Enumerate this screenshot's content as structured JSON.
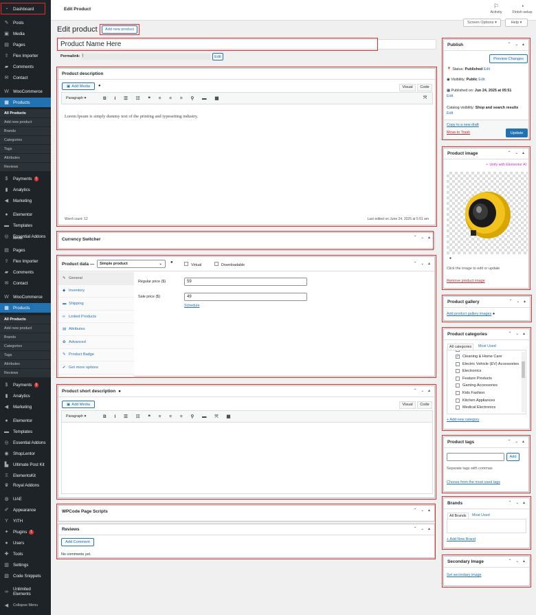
{
  "sidebar": {
    "top_items": [
      {
        "label": "Dashboard",
        "icon": "dashboard-icon",
        "glyph": "◔"
      },
      {
        "label": "Posts",
        "icon": "pin-icon",
        "glyph": "✎"
      },
      {
        "label": "Media",
        "icon": "media-icon",
        "glyph": "▣"
      },
      {
        "label": "Pages",
        "icon": "pages-icon",
        "glyph": "▤"
      },
      {
        "label": "Flex Importer",
        "icon": "importer-icon",
        "glyph": "⇪"
      },
      {
        "label": "Comments",
        "icon": "comments-icon",
        "glyph": "▰"
      },
      {
        "label": "Contact",
        "icon": "mail-icon",
        "glyph": "✉"
      },
      {
        "label": "WooCommerce",
        "icon": "woo-icon",
        "glyph": "W"
      },
      {
        "label": "Products",
        "icon": "products-icon",
        "glyph": "▦"
      }
    ],
    "products_sub": [
      "All Products",
      "Add new product",
      "Brands",
      "Categories",
      "Tags",
      "Attributes",
      "Reviews"
    ],
    "mid_items": [
      {
        "label": "Payments",
        "icon": "payments-icon",
        "glyph": "$",
        "badge": "1"
      },
      {
        "label": "Analytics",
        "icon": "analytics-icon",
        "glyph": "▮"
      },
      {
        "label": "Marketing",
        "icon": "megaphone-icon",
        "glyph": "◀"
      },
      {
        "label": "Elementor",
        "icon": "elementor-icon",
        "glyph": "●"
      },
      {
        "label": "Templates",
        "icon": "folder-icon",
        "glyph": "▬"
      },
      {
        "label": "Essential Addons",
        "icon": "ea-icon",
        "glyph": "◎"
      }
    ],
    "overlap_label": "Media",
    "repeat_items": [
      {
        "label": "Pages",
        "icon": "pages-icon",
        "glyph": "▤"
      },
      {
        "label": "Flex Importer",
        "icon": "importer-icon",
        "glyph": "⇪"
      },
      {
        "label": "Comments",
        "icon": "comments-icon",
        "glyph": "▰"
      },
      {
        "label": "Contact",
        "icon": "mail-icon",
        "glyph": "✉"
      },
      {
        "label": "WooCommerce",
        "icon": "woo-icon",
        "glyph": "W"
      },
      {
        "label": "Products",
        "icon": "products-icon",
        "glyph": "▦"
      }
    ],
    "bottom_items": [
      {
        "label": "Payments",
        "icon": "payments-icon",
        "glyph": "$",
        "badge": "1"
      },
      {
        "label": "Analytics",
        "icon": "analytics-icon",
        "glyph": "▮"
      },
      {
        "label": "Marketing",
        "icon": "megaphone-icon",
        "glyph": "◀"
      },
      {
        "label": "Elementor",
        "icon": "elementor-icon",
        "glyph": "●"
      },
      {
        "label": "Templates",
        "icon": "folder-icon",
        "glyph": "▬"
      },
      {
        "label": "Essential Addons",
        "icon": "ea-icon",
        "glyph": "◎"
      },
      {
        "label": "ShopLentor",
        "icon": "shoplentor-icon",
        "glyph": "◉"
      },
      {
        "label": "Ultimate Post Kit",
        "icon": "upk-icon",
        "glyph": "▙"
      },
      {
        "label": "ElementsKit",
        "icon": "ek-icon",
        "glyph": "Ξ"
      },
      {
        "label": "Royal Addons",
        "icon": "crown-icon",
        "glyph": "♛"
      },
      {
        "label": "UAE",
        "icon": "uae-icon",
        "glyph": "◍"
      },
      {
        "label": "Appearance",
        "icon": "brush-icon",
        "glyph": "✐"
      },
      {
        "label": "YITH",
        "icon": "yith-icon",
        "glyph": "Y"
      },
      {
        "label": "Plugins",
        "icon": "plugin-icon",
        "glyph": "✦",
        "badge": "1"
      },
      {
        "label": "Users",
        "icon": "users-icon",
        "glyph": "●"
      },
      {
        "label": "Tools",
        "icon": "tools-icon",
        "glyph": "✚"
      },
      {
        "label": "Settings",
        "icon": "settings-icon",
        "glyph": "▥"
      },
      {
        "label": "Code Snippets",
        "icon": "code-icon",
        "glyph": "▧"
      }
    ],
    "unlimited_elements": "Unlimited Elements",
    "collapse": "Collapse Menu"
  },
  "topbar": {
    "title": "Edit Product",
    "activity": "Activity",
    "finish": "Finish setup"
  },
  "header": {
    "heading": "Edit product",
    "add_new": "Add new product",
    "screen_options": "Screen Options ▾",
    "help": "Help ▾"
  },
  "product": {
    "title": "Product Name Here",
    "permalink_label": "Permalink:",
    "permalink_value": "|",
    "edit": "Edit"
  },
  "description": {
    "title": "Product description",
    "add_media": "Add Media",
    "tab_visual": "Visual",
    "tab_code": "Code",
    "format": "Paragraph",
    "content": "Lorem Ipsum is simply dummy text of the printing and typesetting industry.",
    "word_count": "Word count: 12",
    "last_edited": "Last edited on June 24, 2025 at 5:51 am"
  },
  "currency": {
    "title": "Currency Switcher"
  },
  "product_data": {
    "title": "Product data —",
    "type": "Simple product",
    "virtual": "Virtual",
    "downloadable": "Downloadable",
    "tabs": [
      {
        "label": "General",
        "glyph": "✎"
      },
      {
        "label": "Inventory",
        "glyph": "◆"
      },
      {
        "label": "Shipping",
        "glyph": "▬"
      },
      {
        "label": "Linked Products",
        "glyph": "∞"
      },
      {
        "label": "Attributes",
        "glyph": "▤"
      },
      {
        "label": "Advanced",
        "glyph": "✿"
      },
      {
        "label": "Product Badge",
        "glyph": "✎"
      },
      {
        "label": "Get more options",
        "glyph": "✔"
      }
    ],
    "regular_label": "Regular price ($)",
    "regular_value": "59",
    "sale_label": "Sale price ($)",
    "sale_value": "49",
    "schedule": "Schedule"
  },
  "short_description": {
    "title": "Product short description",
    "add_media": "Add Media",
    "tab_visual": "Visual",
    "tab_code": "Code",
    "format": "Paragraph"
  },
  "wpcode": {
    "title": "WPCode Page Scripts"
  },
  "reviews": {
    "title": "Reviews",
    "add_comment": "Add Comment",
    "none": "No comments yet."
  },
  "publish": {
    "title": "Publish",
    "preview": "Preview Changes",
    "status_label": "Status:",
    "status_value": "Published",
    "visibility_label": "Visibility:",
    "visibility_value": "Public",
    "published_label": "Published on:",
    "published_value": "Jun 24, 2025 at 05:51",
    "catalog_label": "Catalog visibility:",
    "catalog_value": "Shop and search results",
    "edit": "Edit",
    "copy": "Copy to a new draft",
    "trash": "Move to Trash",
    "update": "Update"
  },
  "product_image": {
    "title": "Product image",
    "unify": "✧ Unify with Elementor AI",
    "hint": "Click the image to edit or update",
    "remove": "Remove product image"
  },
  "gallery": {
    "title": "Product gallery",
    "add": "Add product gallery images"
  },
  "categories": {
    "title": "Product categories",
    "tab_all": "All categories",
    "tab_used": "Most Used",
    "items": [
      {
        "label": "Cleaning & Home Care",
        "checked": true
      },
      {
        "label": "Electric Vehicle (EV) Accessories",
        "checked": false
      },
      {
        "label": "Electronics",
        "checked": false
      },
      {
        "label": "Feature Products",
        "checked": false
      },
      {
        "label": "Gaming Accessories",
        "checked": false
      },
      {
        "label": "Kids Fashion",
        "checked": false
      },
      {
        "label": "Kitchen Appliances",
        "checked": false
      },
      {
        "label": "Medical Electronics",
        "checked": false
      }
    ],
    "add_new": "+ Add new category"
  },
  "tags": {
    "title": "Product tags",
    "add": "Add",
    "hint": "Separate tags with commas",
    "choose": "Choose from the most used tags"
  },
  "brands": {
    "title": "Brands",
    "tab_all": "All Brands",
    "tab_used": "Most Used",
    "add_new": "+ Add New Brand"
  },
  "secondary": {
    "title": "Secondary Image",
    "set": "Set secondary image"
  },
  "colors": {
    "accent": "#2271b1",
    "sidebar": "#1d2327",
    "highlight": "#e32d2d"
  }
}
